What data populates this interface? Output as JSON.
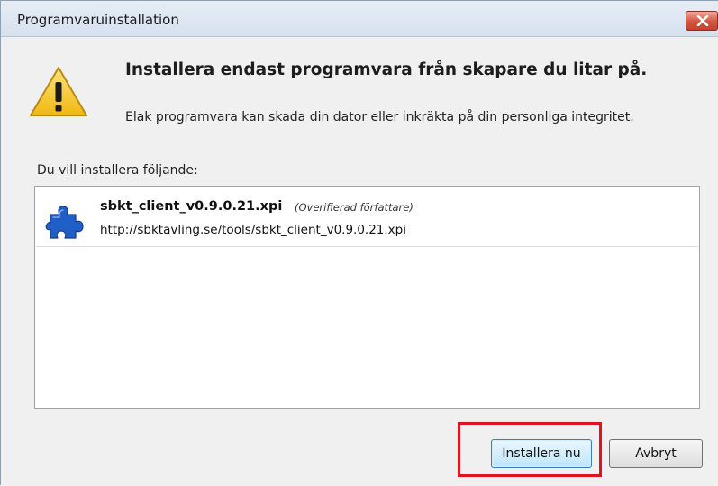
{
  "window": {
    "title": "Programvaruinstallation"
  },
  "icons": {
    "close": "close-icon",
    "warning": "warning-icon",
    "addon": "puzzle-piece-icon"
  },
  "message": {
    "heading": "Installera endast programvara från skapare du litar på.",
    "body": "Elak programvara kan skada din dator eller inkräkta på din personliga integritet."
  },
  "list": {
    "label": "Du vill installera följande:",
    "items": [
      {
        "name": "sbkt_client_v0.9.0.21.xpi",
        "author": "(Overifierad författare)",
        "url": "http://sbktavling.se/tools/sbkt_client_v0.9.0.21.xpi"
      }
    ]
  },
  "buttons": {
    "install": "Installera nu",
    "cancel": "Avbryt"
  },
  "colors": {
    "highlight": "#e0141e",
    "puzzle": "#1f5fc7",
    "warning": "#f2c419"
  }
}
